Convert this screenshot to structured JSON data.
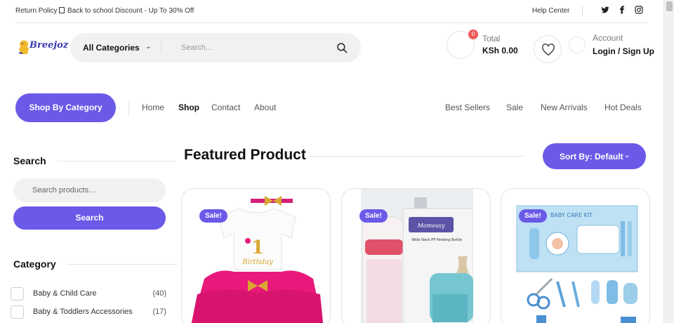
{
  "topbar": {
    "return_policy": "Return Policy",
    "promo": "Back to school Discount - Up To 30% Off",
    "help_center": "Help Center",
    "social": [
      "twitter-icon",
      "facebook-icon",
      "instagram-icon"
    ]
  },
  "header": {
    "logo_text": "Breejoz",
    "category_select": "All Categories",
    "search_placeholder": "Search...",
    "cart": {
      "badge": "0",
      "label": "Total",
      "value": "KSh 0.00"
    },
    "account": {
      "label": "Account",
      "value": "Login / Sign Up"
    }
  },
  "nav": {
    "shop_by_category": "Shop By Category",
    "left": [
      "Home",
      "Shop",
      "Contact",
      "About"
    ],
    "active": "Shop",
    "right": [
      "Best Sellers",
      "Sale",
      "New Arrivals",
      "Hot Deals"
    ]
  },
  "sidebar": {
    "search_title": "Search",
    "search_placeholder": "Search products…",
    "search_button": "Search",
    "category_title": "Category",
    "categories": [
      {
        "name": "Baby & Child Care",
        "count": "(40)"
      },
      {
        "name": "Baby & Toddlers Accessories",
        "count": "(17)"
      }
    ]
  },
  "main": {
    "title": "Featured Product",
    "sort_label": "Sort By: Default",
    "products": [
      {
        "badge": "Sale!",
        "image": "pink-birthday-tutu-outfit"
      },
      {
        "badge": "Sale!",
        "image": "baby-feeding-bottle-box"
      },
      {
        "badge": "Sale!",
        "image": "baby-care-kit-set"
      }
    ]
  },
  "colors": {
    "accent": "#6b5ae8",
    "badge_red": "#ef5a5a",
    "tutu_pink": "#e8197a"
  }
}
